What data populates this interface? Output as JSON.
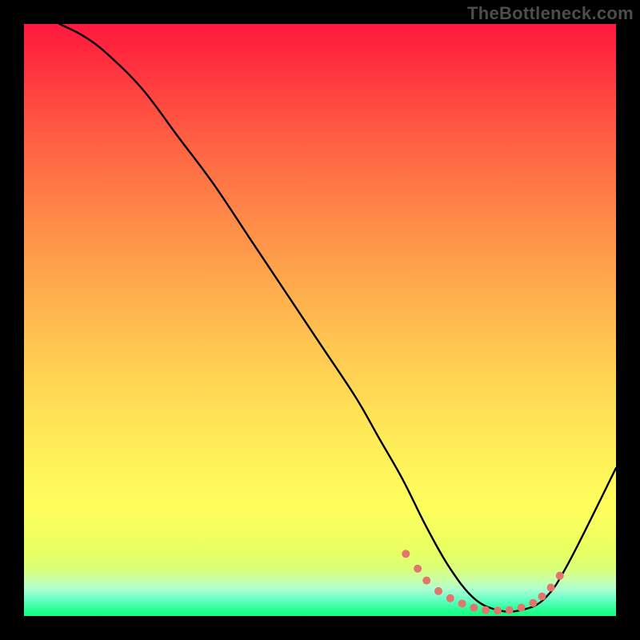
{
  "watermark": "TheBottleneck.com",
  "chart_data": {
    "type": "line",
    "title": "",
    "xlabel": "",
    "ylabel": "",
    "xlim": [
      0,
      100
    ],
    "ylim": [
      0,
      100
    ],
    "series": [
      {
        "name": "curve",
        "color": "#000000",
        "x": [
          6,
          10,
          14,
          20,
          26,
          32,
          38,
          44,
          50,
          56,
          60,
          64,
          68,
          72,
          76,
          80,
          84,
          88,
          92,
          100
        ],
        "y": [
          100,
          98,
          95,
          89,
          81,
          73,
          64,
          55,
          46,
          37,
          30,
          23,
          15,
          8,
          3,
          1,
          1,
          3,
          9,
          25
        ]
      }
    ],
    "markers": {
      "name": "bottom-dots",
      "color": "#e2766c",
      "x": [
        64.5,
        66.5,
        68,
        70,
        72,
        74,
        76,
        78,
        80,
        82,
        84,
        86,
        87.5,
        89,
        90.5
      ],
      "y": [
        10.5,
        8,
        6,
        4.2,
        3,
        2.1,
        1.4,
        1.0,
        0.9,
        1.0,
        1.4,
        2.2,
        3.3,
        4.8,
        6.8
      ]
    },
    "gradient_stops": [
      {
        "pos": 0,
        "color": "#ff193f"
      },
      {
        "pos": 0.5,
        "color": "#ffc050"
      },
      {
        "pos": 0.78,
        "color": "#fff95b"
      },
      {
        "pos": 0.95,
        "color": "#c8ffaa"
      },
      {
        "pos": 1.0,
        "color": "#10ff7e"
      }
    ]
  }
}
